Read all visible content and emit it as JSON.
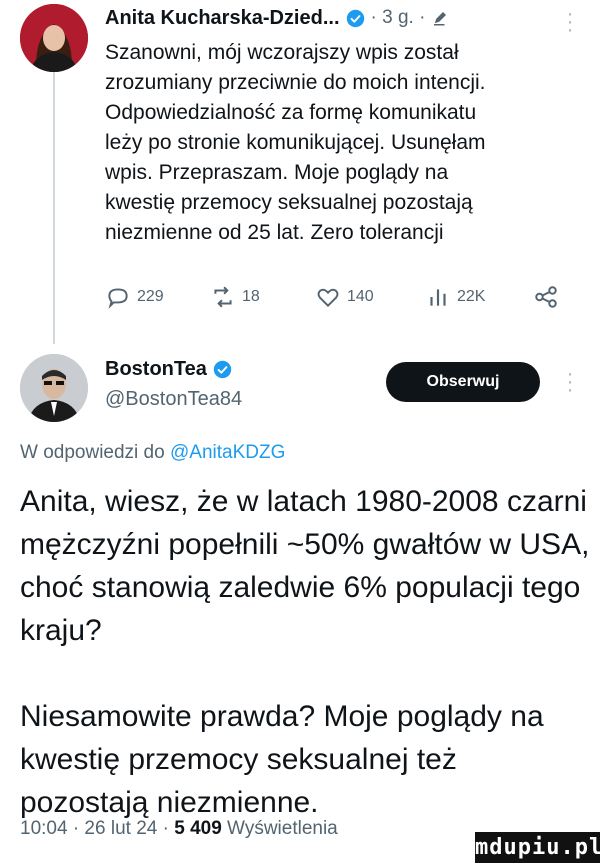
{
  "tweet_reply": {
    "author_name": "Anita Kucharska-Dzied...",
    "time_meta": "· 3 g. ·",
    "text": "Szanowni, mój wczorajszy wpis został\nzrozumiany przeciwnie do moich intencji.\nOdpowiedzialność za formę komunikatu\nleży po stronie komunikującej. Usunęłam\nwpis. Przepraszam. Moje poglądy na\nkwestię przemocy seksualnej pozostają\nniezmienne od 25 lat. Zero tolerancji",
    "stats": {
      "replies": "229",
      "reposts": "18",
      "likes": "140",
      "views": "22K"
    }
  },
  "tweet_main": {
    "author_name": "BostonTea",
    "handle": "@BostonTea84",
    "follow_label": "Obserwuj",
    "reply_to_prefix": "W odpowiedzi do",
    "reply_to_mention": "@AnitaKDZG",
    "paragraph1": "Anita, wiesz, że w latach 1980-2008 czarni mężczyźni popełnili ~50% gwałtów w USA, choć stanowią zaledwie 6% populacji tego kraju?",
    "paragraph2": "Niesamowite prawda? Moje poglądy na kwestię przemocy seksualnej też pozostają niezmienne.",
    "footer_time": "10:04 · 26 lut 24 ·",
    "footer_views_count": "5 409",
    "footer_views_label": "Wyświetlenia"
  },
  "watermark": "mdupiu.pl",
  "colors": {
    "accent": "#1d9bf0",
    "text": "#0f1419",
    "muted": "#536471",
    "button": "#0f1419"
  }
}
